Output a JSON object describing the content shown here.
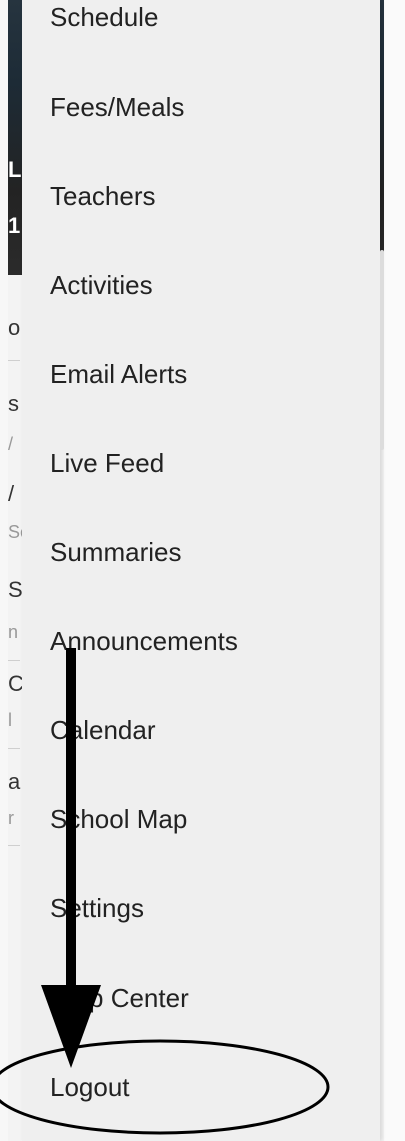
{
  "drawer": {
    "items": [
      {
        "label": "Schedule"
      },
      {
        "label": "Fees/Meals"
      },
      {
        "label": "Teachers"
      },
      {
        "label": "Activities"
      },
      {
        "label": "Email Alerts"
      },
      {
        "label": "Live Feed"
      },
      {
        "label": "Summaries"
      },
      {
        "label": "Announcements"
      },
      {
        "label": "Calendar"
      },
      {
        "label": "School Map"
      },
      {
        "label": "Settings"
      },
      {
        "label": "Help Center"
      },
      {
        "label": "Logout"
      }
    ]
  },
  "background": {
    "fragments": [
      "L",
      "1",
      "o",
      "s",
      "/",
      "/",
      "Se",
      "S",
      "n",
      "C",
      "l",
      "a",
      "r"
    ]
  },
  "colors": {
    "drawer_bg": "#efefef",
    "header_dark": "#1d2b36",
    "annotation": "#000000"
  }
}
